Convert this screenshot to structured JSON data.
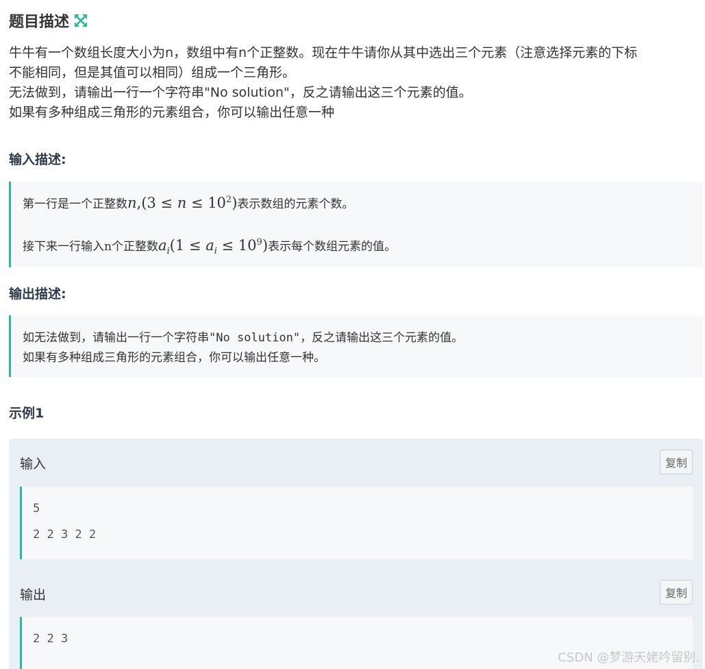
{
  "header": {
    "title": "题目描述",
    "icon": "expand-icon",
    "accent_color": "#25bb9b"
  },
  "description": {
    "lines": [
      "牛牛有一个数组长度大小为n，数组中有n个正整数。现在牛牛请你从其中选出三个元素（注意选择元素的下标",
      "不能相同，但是其值可以相同）组成一个三角形。",
      "无法做到，请输出一行一个字符串\"No solution\"，反之请输出这三个元素的值。",
      "如果有多种组成三角形的元素组合，你可以输出任意一种"
    ]
  },
  "input_section": {
    "heading": "输入描述:",
    "line1_pre": "第一行是一个正整数",
    "line1_math_var": "n",
    "line1_math_expr_a": ",(3 ≤ ",
    "line1_math_expr_b": "n",
    "line1_math_expr_c": " ≤ 10",
    "line1_math_sup": "2",
    "line1_math_close": ")",
    "line1_post": "表示数组的元素个数。",
    "line2_pre": "接下来一行输入n个正整数",
    "line2_math_var": "a",
    "line2_math_sub": "i",
    "line2_math_expr_a": "(1 ≤ ",
    "line2_math_var2": "a",
    "line2_math_sub2": "i",
    "line2_math_expr_c": " ≤ 10",
    "line2_math_sup": "9",
    "line2_math_close": ")",
    "line2_post": "表示每个数组元素的值。"
  },
  "output_section": {
    "heading": "输出描述:",
    "line1_pre": "如无法做到，请输出一行一个字符串",
    "line1_code": "\"No solution\"",
    "line1_post": "，反之请输出这三个元素的值。",
    "line2": "如果有多种组成三角形的元素组合，你可以输出任意一种。"
  },
  "example": {
    "heading": "示例1",
    "input_label": "输入",
    "output_label": "输出",
    "copy_label": "复制",
    "input_lines": [
      "5",
      "2 2 3 2 2"
    ],
    "output_lines": [
      "2 2 3"
    ]
  },
  "watermark": "CSDN @梦游天姥吟留别."
}
